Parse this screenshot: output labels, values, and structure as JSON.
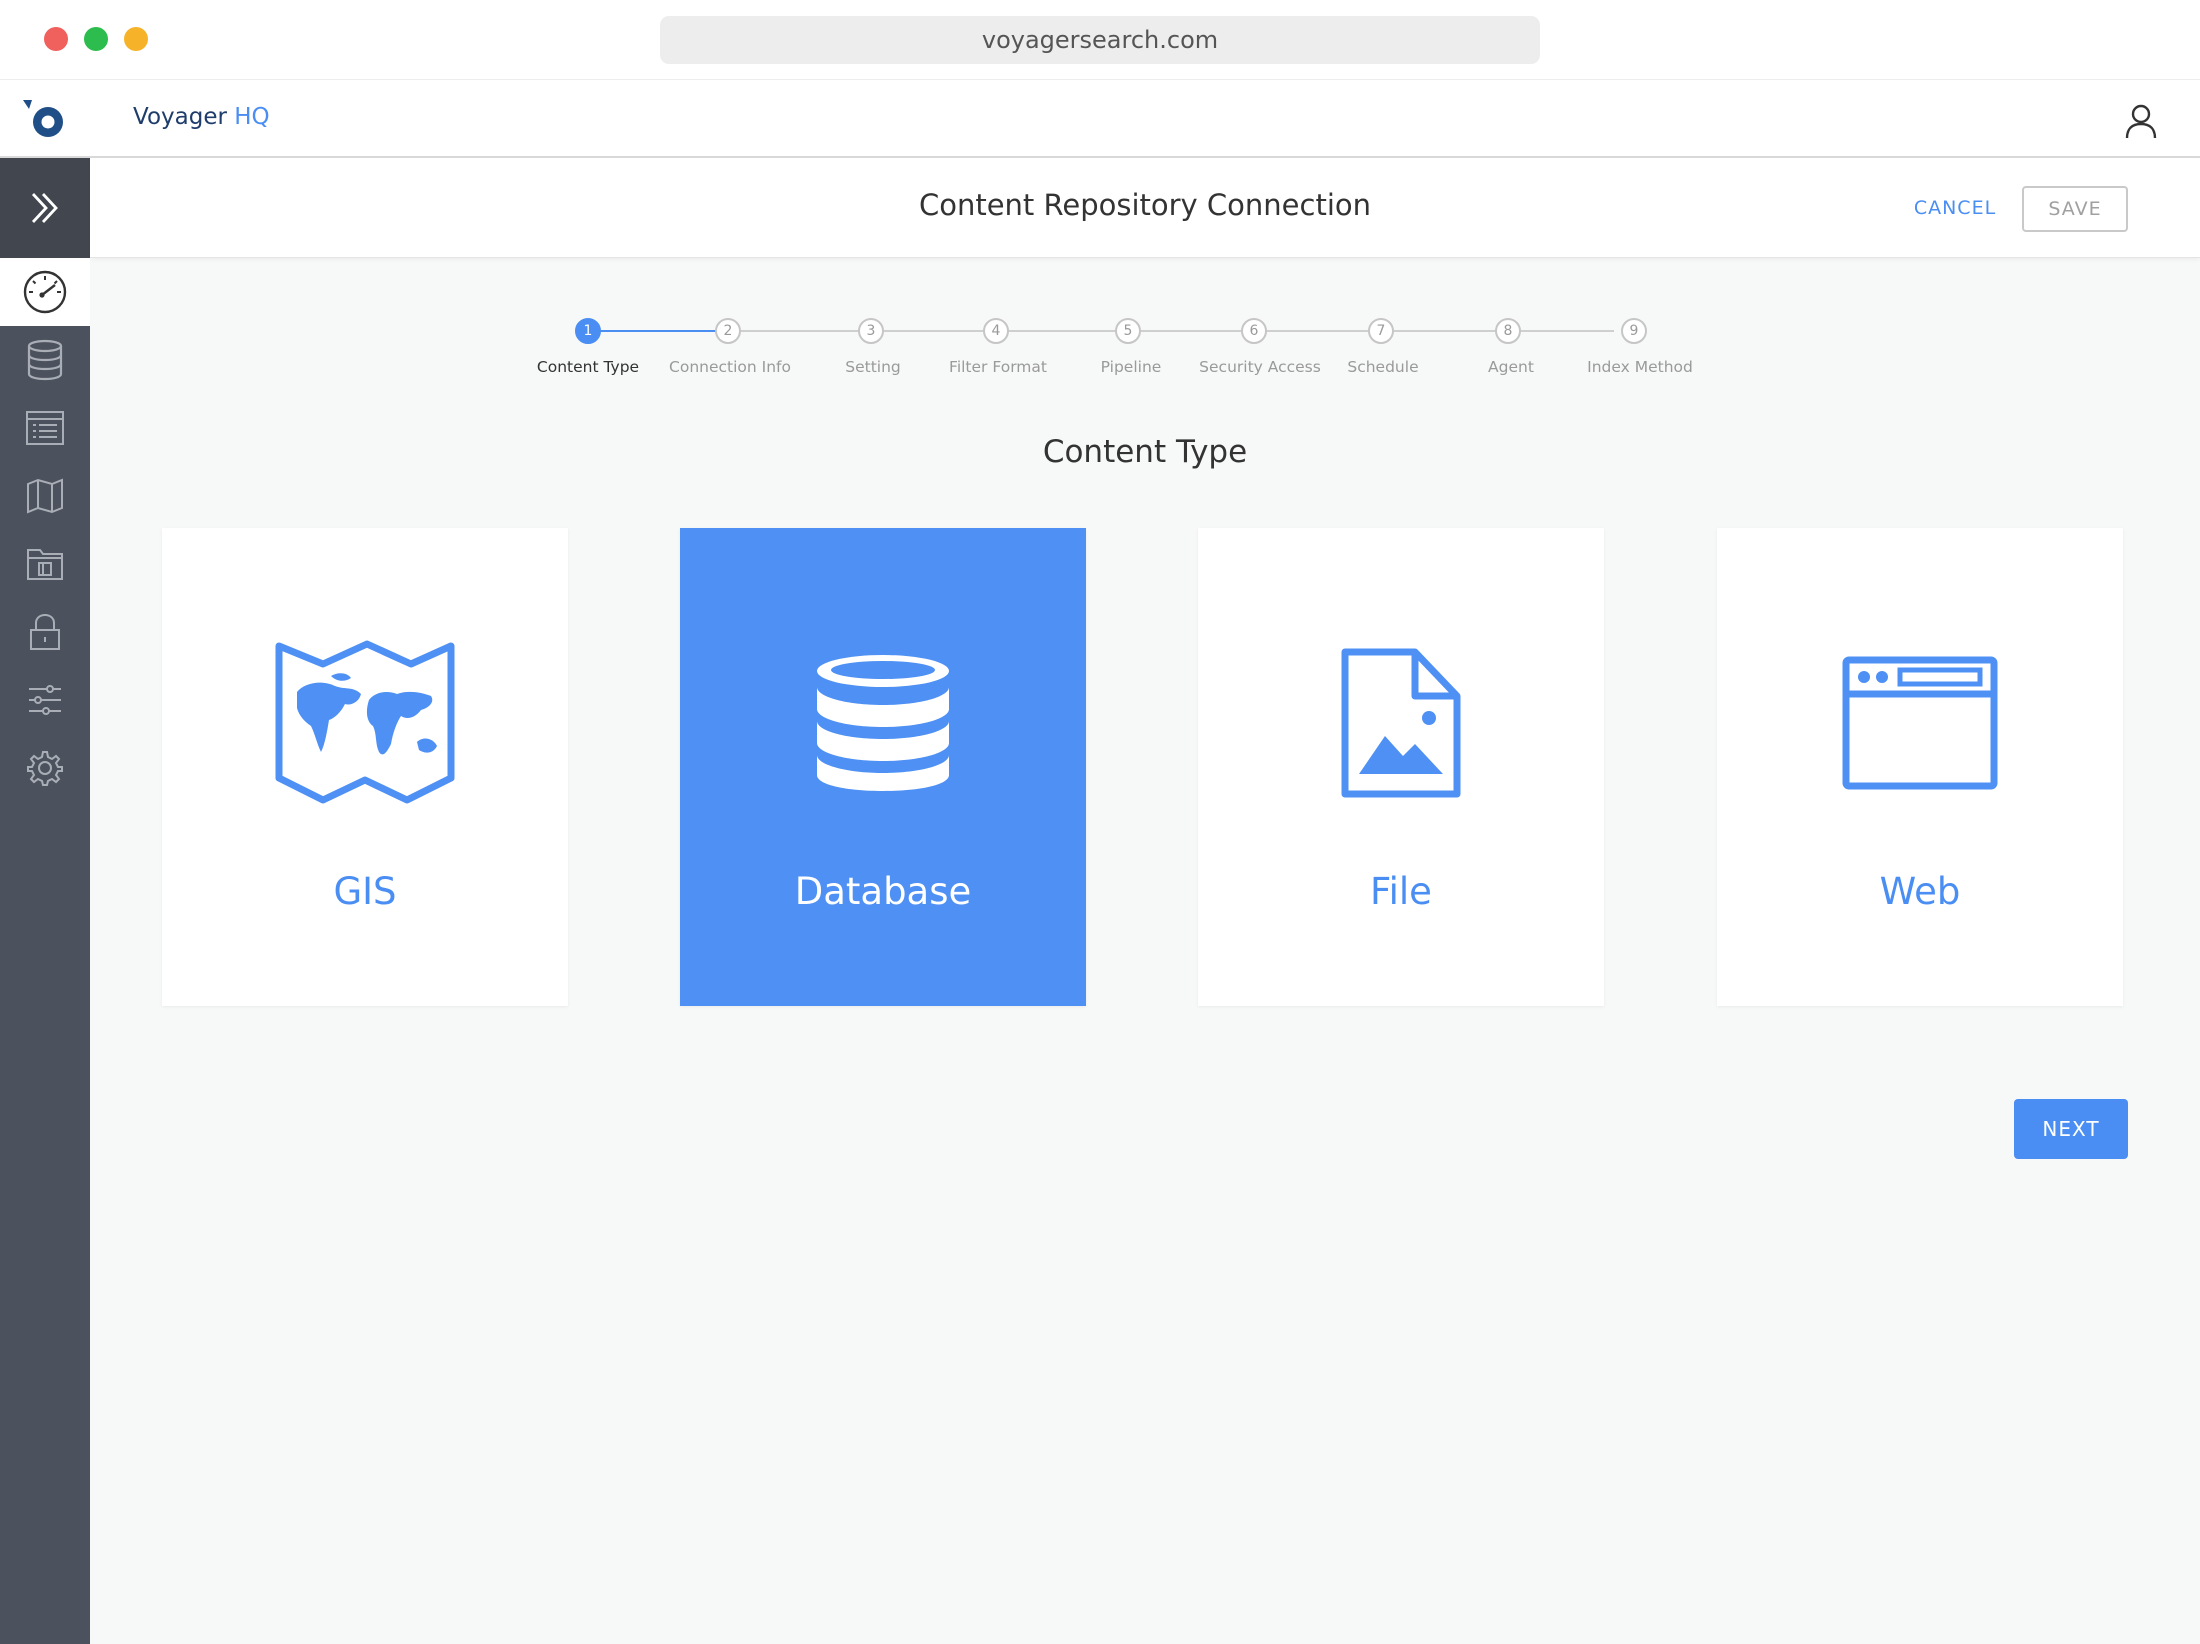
{
  "browser": {
    "url": "voyagersearch.com"
  },
  "header": {
    "brand": "Voyager",
    "brand_suffix": "HQ"
  },
  "sidebar": {
    "items": [
      {
        "name": "dashboard",
        "icon": "gauge-icon",
        "active": true
      },
      {
        "name": "database",
        "icon": "database-icon"
      },
      {
        "name": "list",
        "icon": "list-icon"
      },
      {
        "name": "map",
        "icon": "map-icon"
      },
      {
        "name": "folder",
        "icon": "folder-icon"
      },
      {
        "name": "security",
        "icon": "lock-icon"
      },
      {
        "name": "settings-sliders",
        "icon": "sliders-icon"
      },
      {
        "name": "settings",
        "icon": "gear-icon"
      }
    ]
  },
  "titlebar": {
    "title": "Content Repository Connection",
    "cancel_label": "CANCEL",
    "save_label": "SAVE"
  },
  "stepper": {
    "steps": [
      {
        "num": "1",
        "label": "Content Type"
      },
      {
        "num": "2",
        "label": "Connection Info"
      },
      {
        "num": "3",
        "label": "Setting"
      },
      {
        "num": "4",
        "label": "Filter Format"
      },
      {
        "num": "5",
        "label": "Pipeline"
      },
      {
        "num": "6",
        "label": "Security Access"
      },
      {
        "num": "7",
        "label": "Schedule"
      },
      {
        "num": "8",
        "label": "Agent"
      },
      {
        "num": "9",
        "label": "Index Method"
      }
    ],
    "current_step": 1
  },
  "content": {
    "section_title": "Content Type",
    "cards": [
      {
        "label": "GIS",
        "icon": "world-map-icon"
      },
      {
        "label": "Database",
        "icon": "database-icon",
        "selected": true
      },
      {
        "label": "File",
        "icon": "image-file-icon"
      },
      {
        "label": "Web",
        "icon": "browser-window-icon"
      }
    ],
    "next_label": "NEXT"
  },
  "colors": {
    "accent": "#4a8ef3",
    "sidebar": "#4c525d",
    "selected_card": "#4e90f4"
  }
}
